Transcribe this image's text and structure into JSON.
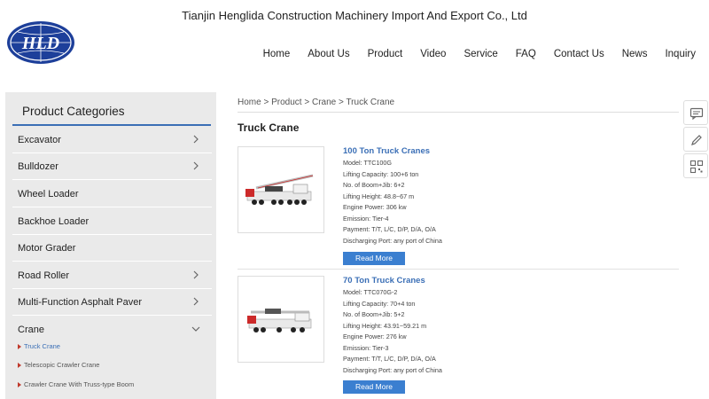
{
  "header": {
    "company_name": "Tianjin Henglida Construction Machinery Import And Export Co., Ltd",
    "logo_text": "HLD"
  },
  "nav": {
    "items": [
      "Home",
      "About Us",
      "Product",
      "Video",
      "Service",
      "FAQ",
      "Contact Us",
      "News",
      "Inquiry"
    ]
  },
  "sidebar": {
    "title": "Product Categories",
    "categories": [
      {
        "label": "Excavator",
        "expandable": true
      },
      {
        "label": "Bulldozer",
        "expandable": true
      },
      {
        "label": "Wheel Loader",
        "expandable": false
      },
      {
        "label": "Backhoe Loader",
        "expandable": false
      },
      {
        "label": "Motor Grader",
        "expandable": false
      },
      {
        "label": "Road Roller",
        "expandable": true
      },
      {
        "label": "Multi-Function Asphalt Paver",
        "expandable": true
      },
      {
        "label": "Crane",
        "expandable": true,
        "expanded": true
      }
    ],
    "subcategories": [
      {
        "label": "Truck Crane",
        "active": true
      },
      {
        "label": "Telescopic Crawler Crane",
        "active": false
      },
      {
        "label": "Crawler Crane With Truss-type Boom",
        "active": false
      }
    ]
  },
  "breadcrumb": {
    "items": [
      "Home",
      "Product",
      "Crane",
      "Truck Crane"
    ],
    "separator": ">"
  },
  "page_title": "Truck Crane",
  "products": [
    {
      "name": "100 Ton Truck Cranes",
      "specs": [
        "Model: TTC100G",
        "Lifting Capacity: 100+6 ton",
        "No. of Boom+Jib: 6+2",
        "Lifting Height: 48.8~67 m",
        "Engine Power: 306 kw",
        "Emission: Tier-4",
        "Payment: T/T, L/C, D/P, D/A, O/A",
        "Discharging Port: any port of China"
      ],
      "button": "Read More"
    },
    {
      "name": "70 Ton Truck Cranes",
      "specs": [
        "Model: TTC070G-2",
        "Lifting Capacity: 70+4 ton",
        "No. of Boom+Jib: 5+2",
        "Lifting Height: 43.91~59.21 m",
        "Engine Power: 276 kw",
        "Emission: Tier-3",
        "Payment: T/T, L/C, D/P, D/A, O/A",
        "Discharging Port: any port of China"
      ],
      "button": "Read More"
    }
  ],
  "side_tools": [
    "chat-icon",
    "edit-icon",
    "qr-code-icon"
  ],
  "colors": {
    "accent": "#3b6fb6",
    "button": "#3b7fd0",
    "sidebar_bg": "#eaeaea",
    "bullet": "#c0392b"
  }
}
